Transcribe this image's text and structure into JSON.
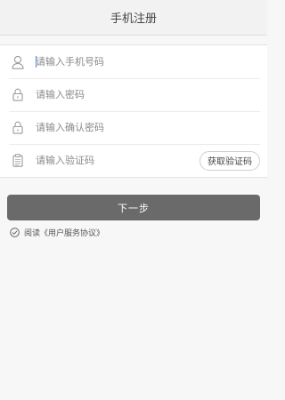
{
  "header": {
    "title": "手机注册"
  },
  "form": {
    "phone": {
      "placeholder": "请输入手机号码",
      "icon": "user-icon"
    },
    "password": {
      "placeholder": "请输入密码",
      "icon": "lock-icon"
    },
    "confirm_password": {
      "placeholder": "请输入确认密码",
      "icon": "lock-icon"
    },
    "verification_code": {
      "placeholder": "请输入验证码",
      "icon": "clipboard-icon",
      "button_label": "获取验证码"
    }
  },
  "next_button": {
    "label": "下一步",
    "color": "#6a6a6a"
  },
  "agreement": {
    "text": "阅读《用户服务协议》",
    "icon": "check-circle-icon",
    "checked": true
  }
}
